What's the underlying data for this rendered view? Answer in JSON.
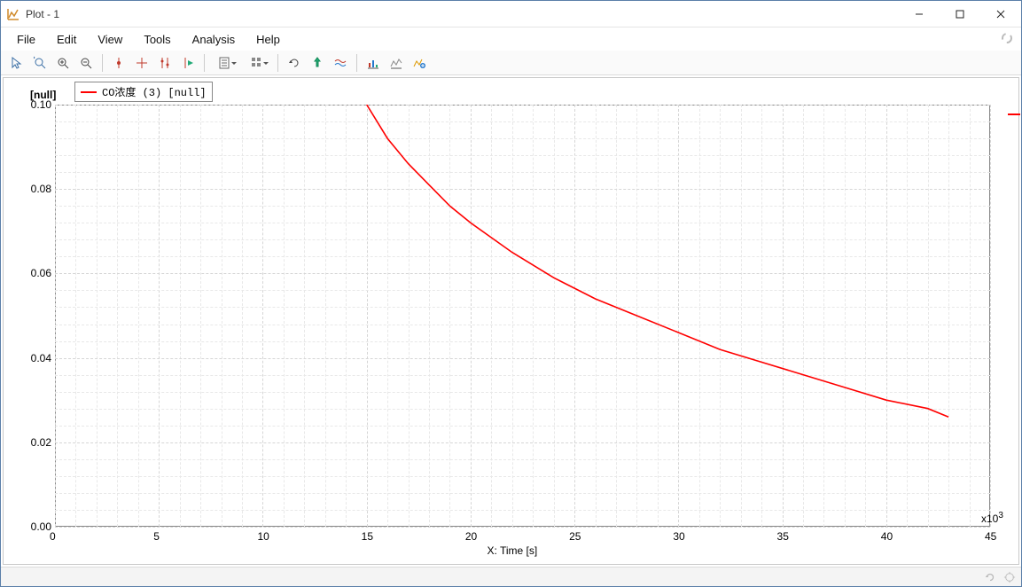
{
  "window": {
    "title": "Plot - 1"
  },
  "menus": {
    "file": "File",
    "edit": "Edit",
    "view": "View",
    "tools": "Tools",
    "analysis": "Analysis",
    "help": "Help"
  },
  "toolbar_icons": [
    "cursor",
    "zoom-circle",
    "zoom-in",
    "zoom-out",
    "sep",
    "marker-single",
    "marker-cross",
    "marker-multi",
    "marker-play",
    "sep",
    "list-props",
    "grid-menu",
    "sep",
    "refresh",
    "pin",
    "layers",
    "sep",
    "chart-bar",
    "chart-stats",
    "chart-add"
  ],
  "legend": {
    "series_label": "CO浓度 (3) [null]"
  },
  "axes": {
    "y_title": "[null]",
    "x_title": "X: Time [s]",
    "x_exponent": "x10",
    "x_exponent_sup": "3",
    "x_ticks": [
      "0",
      "5",
      "10",
      "15",
      "20",
      "25",
      "30",
      "35",
      "40",
      "45"
    ],
    "y_ticks": [
      "0.00",
      "0.02",
      "0.04",
      "0.06",
      "0.08",
      "0.10"
    ]
  },
  "chart_data": {
    "type": "line",
    "title": "",
    "xlabel": "X: Time [s]",
    "ylabel": "[null]",
    "xlim": [
      0,
      45000
    ],
    "ylim": [
      0,
      0.1
    ],
    "x_scale_note": "x-axis displayed as value × 10^3",
    "series": [
      {
        "name": "CO浓度 (3) [null]",
        "color": "#ff0000",
        "x": [
          15000,
          16000,
          17000,
          18000,
          19000,
          20000,
          22000,
          24000,
          26000,
          28000,
          30000,
          32000,
          34000,
          36000,
          38000,
          40000,
          42000,
          43000
        ],
        "y": [
          0.1,
          0.092,
          0.086,
          0.081,
          0.076,
          0.072,
          0.065,
          0.059,
          0.054,
          0.05,
          0.046,
          0.042,
          0.039,
          0.036,
          0.033,
          0.03,
          0.028,
          0.026
        ]
      }
    ]
  }
}
